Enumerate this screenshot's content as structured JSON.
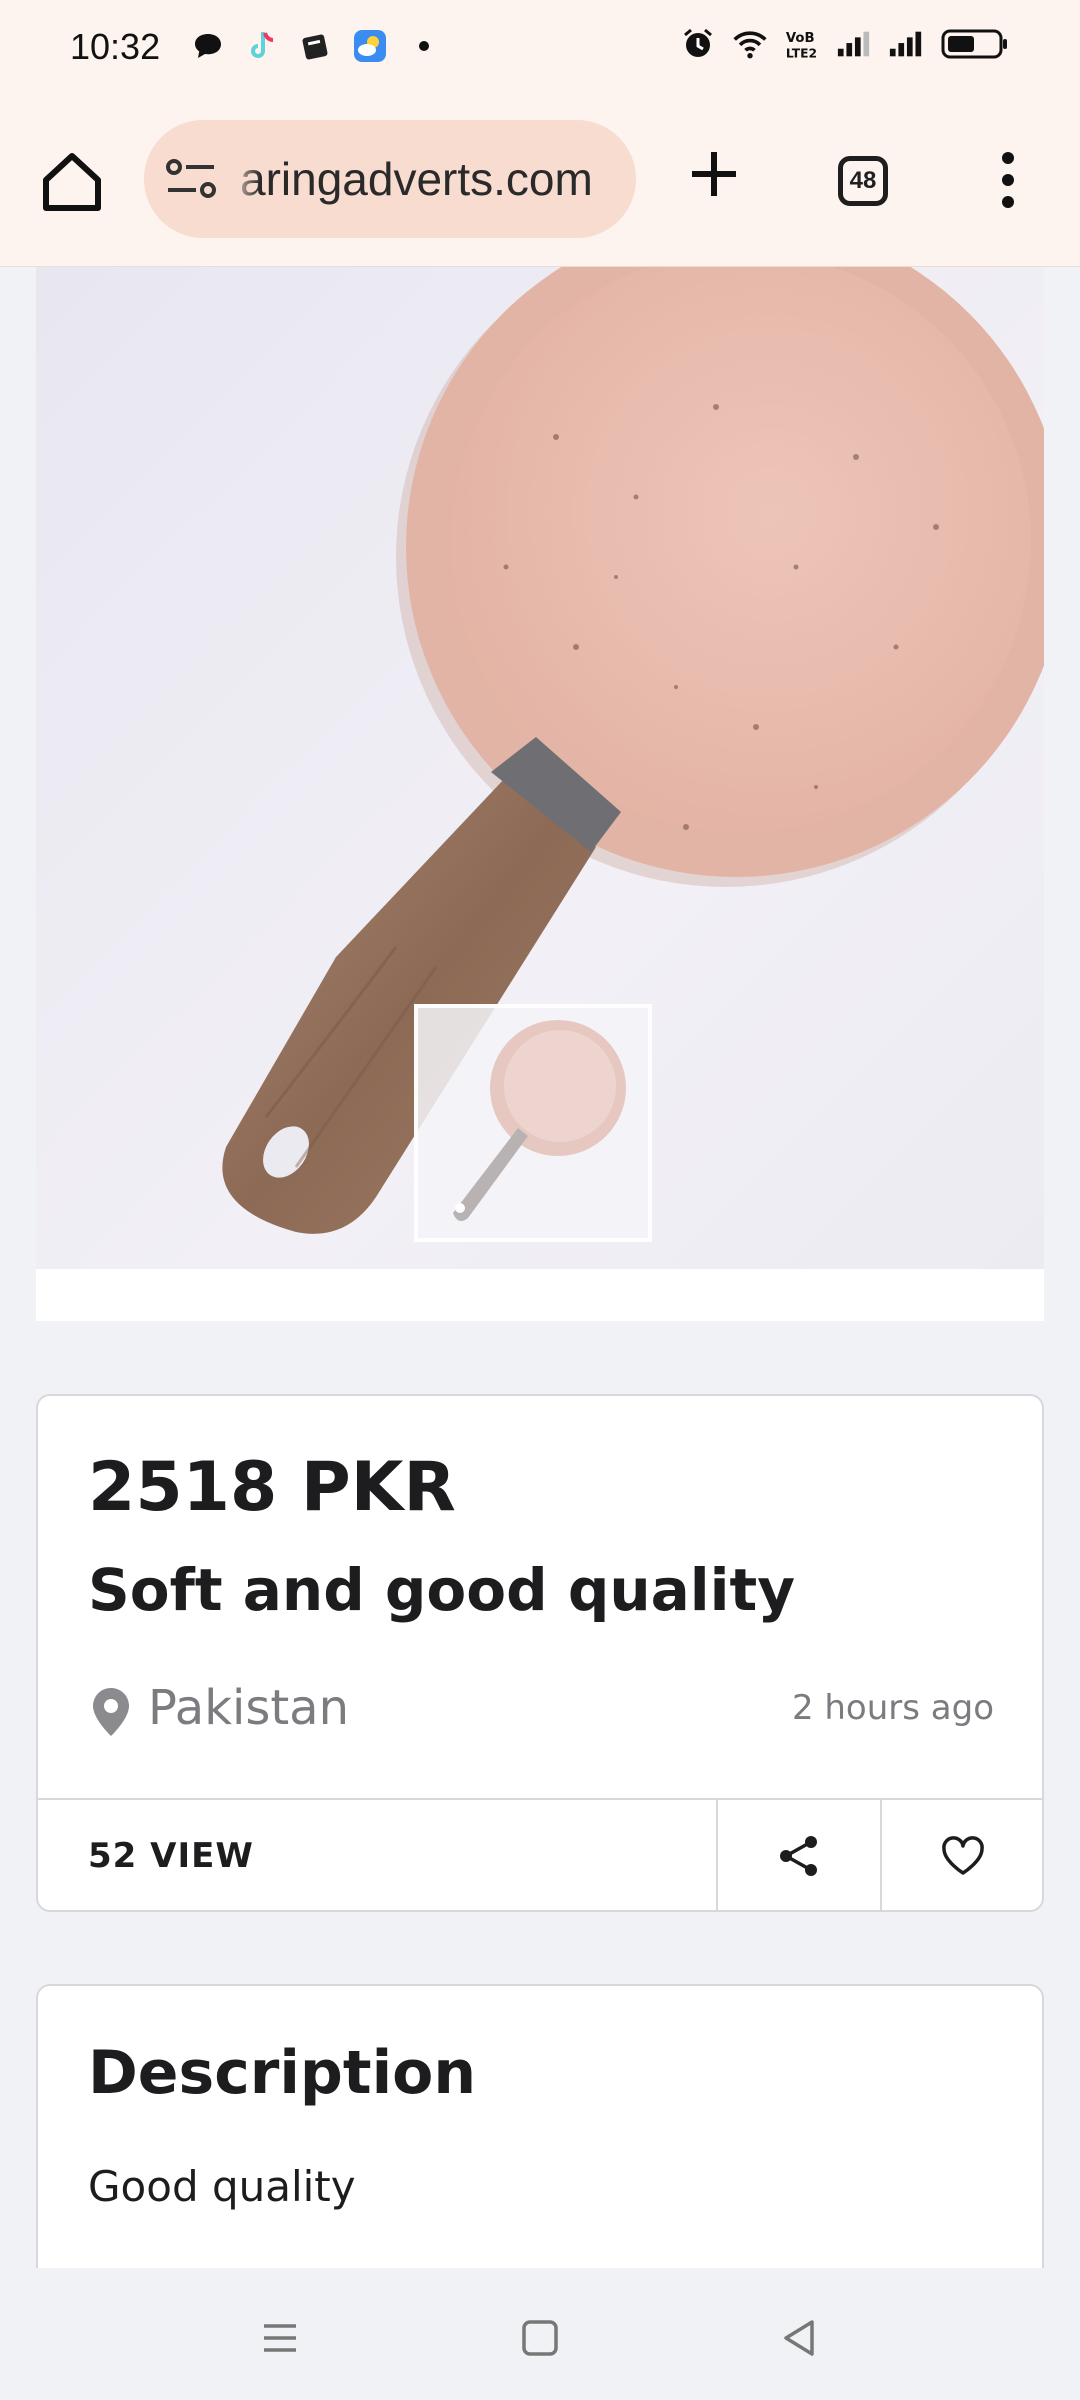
{
  "status_bar": {
    "time": "10:32",
    "left_icons": [
      "chat-bubble-icon",
      "tiktok-icon",
      "book-app-icon",
      "weather-app-icon",
      "dot-icon"
    ],
    "right_icons": [
      "alarm-icon",
      "wifi-icon",
      "volte-icon",
      "signal-icon",
      "signal-icon",
      "battery-icon"
    ],
    "volte_text": "VoB LTE2"
  },
  "browser": {
    "url": "aringadverts.com",
    "tab_count": "48",
    "icons": [
      "home-icon",
      "site-info-icon",
      "plus-icon",
      "tabs-icon",
      "more-vert-icon"
    ]
  },
  "listing": {
    "image_subject": "pink speckled frying pan with wooden handle",
    "price": "2518 PKR",
    "title": "Soft and good quality",
    "location": "Pakistan",
    "posted": "2 hours ago",
    "views": "52 VIEW",
    "actions": [
      "share-icon",
      "heart-icon"
    ]
  },
  "description": {
    "heading": "Description",
    "body": "Good quality"
  },
  "nav_bar": {
    "icons": [
      "menu-icon",
      "home-square-icon",
      "back-triangle-icon"
    ]
  },
  "colors": {
    "browser_bg": "#fdf3ef",
    "url_pill": "#f7dccf",
    "page_bg": "#f1f2f6",
    "pan_pink": "#e8bfb2",
    "handle_wood": "#9a7661"
  }
}
